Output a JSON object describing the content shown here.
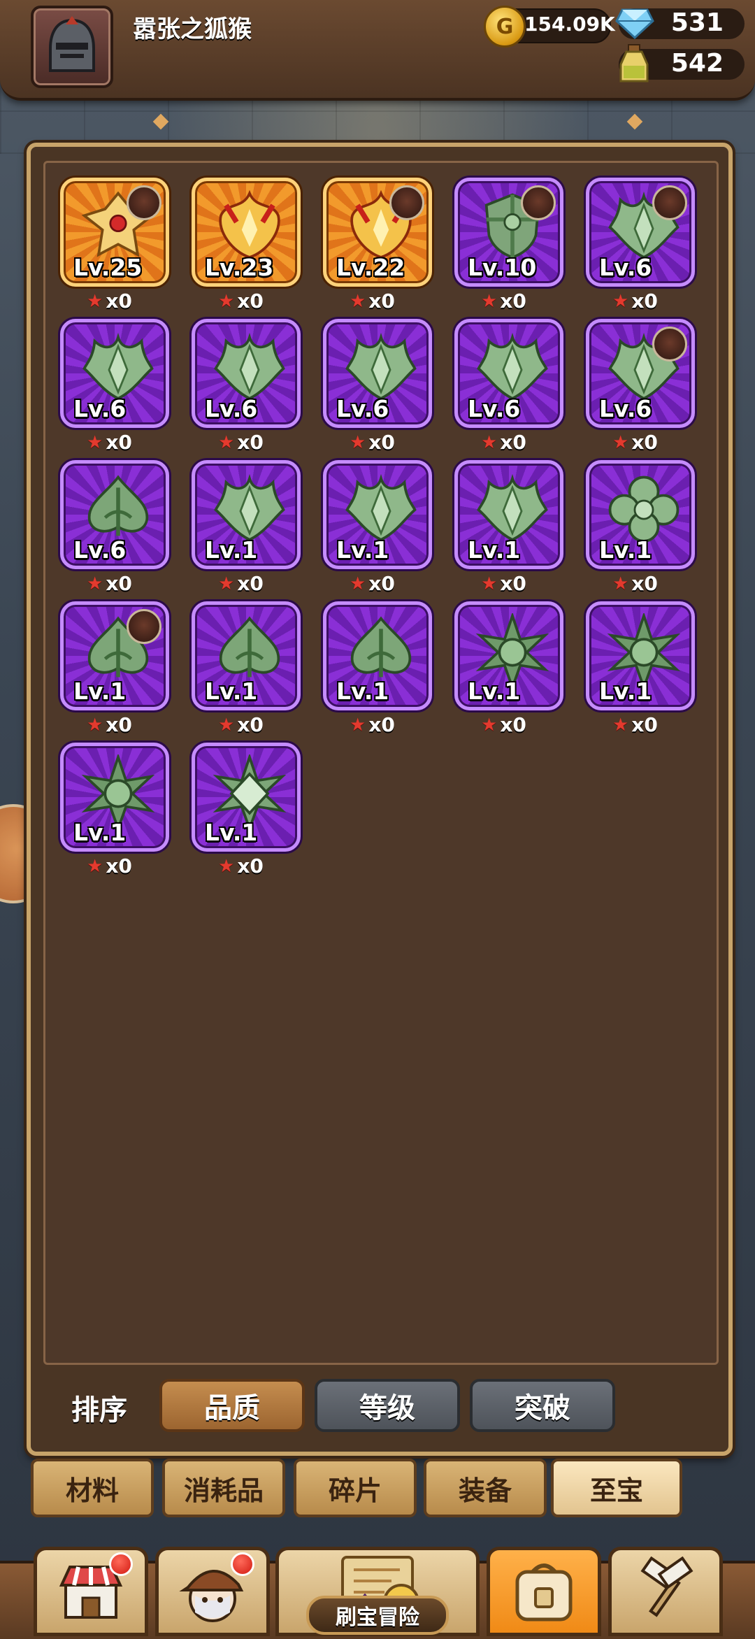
{
  "header": {
    "player_name": "嚣张之狐猴",
    "gold": "154.09K",
    "gems": "531",
    "potions": "542"
  },
  "items": [
    {
      "level": "Lv.25",
      "stars": "x0",
      "rarity": "orange",
      "icon": "golden-cross-shield-icon",
      "badge": true
    },
    {
      "level": "Lv.23",
      "stars": "x0",
      "rarity": "orange",
      "icon": "flame-crest-icon",
      "badge": false
    },
    {
      "level": "Lv.22",
      "stars": "x0",
      "rarity": "orange",
      "icon": "flame-crest-icon",
      "badge": true
    },
    {
      "level": "Lv.10",
      "stars": "x0",
      "rarity": "purple",
      "icon": "green-shield-icon",
      "badge": true
    },
    {
      "level": "Lv.6",
      "stars": "x0",
      "rarity": "purple",
      "icon": "green-crest-icon",
      "badge": true
    },
    {
      "level": "Lv.6",
      "stars": "x0",
      "rarity": "purple",
      "icon": "green-crest-icon",
      "badge": false
    },
    {
      "level": "Lv.6",
      "stars": "x0",
      "rarity": "purple",
      "icon": "green-crest-icon",
      "badge": false
    },
    {
      "level": "Lv.6",
      "stars": "x0",
      "rarity": "purple",
      "icon": "green-crest-icon",
      "badge": false
    },
    {
      "level": "Lv.6",
      "stars": "x0",
      "rarity": "purple",
      "icon": "green-crest-icon",
      "badge": false
    },
    {
      "level": "Lv.6",
      "stars": "x0",
      "rarity": "purple",
      "icon": "green-crest-icon",
      "badge": true
    },
    {
      "level": "Lv.6",
      "stars": "x0",
      "rarity": "purple",
      "icon": "green-spade-icon",
      "badge": false
    },
    {
      "level": "Lv.1",
      "stars": "x0",
      "rarity": "purple",
      "icon": "green-crest-icon",
      "badge": false
    },
    {
      "level": "Lv.1",
      "stars": "x0",
      "rarity": "purple",
      "icon": "green-crest-icon",
      "badge": false
    },
    {
      "level": "Lv.1",
      "stars": "x0",
      "rarity": "purple",
      "icon": "green-crest-icon",
      "badge": false
    },
    {
      "level": "Lv.1",
      "stars": "x0",
      "rarity": "purple",
      "icon": "green-clover-icon",
      "badge": false
    },
    {
      "level": "Lv.1",
      "stars": "x0",
      "rarity": "purple",
      "icon": "green-spade-icon",
      "badge": true
    },
    {
      "level": "Lv.1",
      "stars": "x0",
      "rarity": "purple",
      "icon": "green-spade-icon",
      "badge": false
    },
    {
      "level": "Lv.1",
      "stars": "x0",
      "rarity": "purple",
      "icon": "green-spade-icon",
      "badge": false
    },
    {
      "level": "Lv.1",
      "stars": "x0",
      "rarity": "purple",
      "icon": "green-star-orb-icon",
      "badge": false
    },
    {
      "level": "Lv.1",
      "stars": "x0",
      "rarity": "purple",
      "icon": "green-star-orb-icon",
      "badge": false
    },
    {
      "level": "Lv.1",
      "stars": "x0",
      "rarity": "purple",
      "icon": "green-star-orb-icon",
      "badge": false
    },
    {
      "level": "Lv.1",
      "stars": "x0",
      "rarity": "purple",
      "icon": "green-diamond-star-icon",
      "badge": false
    }
  ],
  "sort": {
    "label": "排序",
    "options": [
      "品质",
      "等级",
      "突破"
    ],
    "active_index": 0
  },
  "tabs": {
    "items": [
      "材料",
      "消耗品",
      "碎片",
      "装备",
      "至宝"
    ],
    "active_index": 4
  },
  "bottom_nav": {
    "items": [
      "shop-icon",
      "hero-icon",
      "adventure-icon",
      "bag-icon",
      "forge-icon"
    ],
    "adventure_label": "刷宝冒险",
    "active": "bag-icon"
  },
  "colors": {
    "purple_rarity": "#8a2fd6",
    "orange_rarity": "#f29a2c",
    "panel": "#4a3524",
    "star": "#e43a2e"
  }
}
